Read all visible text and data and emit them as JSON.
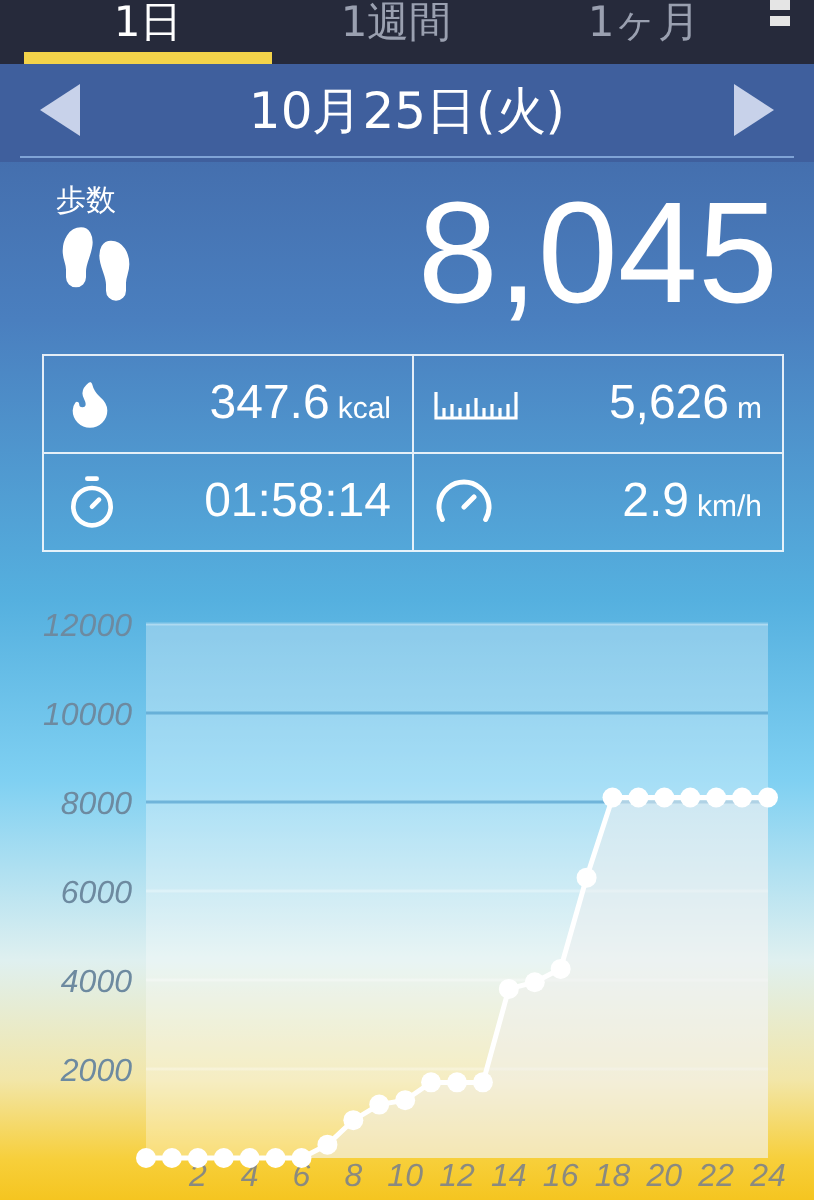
{
  "tabs": [
    {
      "label": "1日",
      "selected": true
    },
    {
      "label": "1週間",
      "selected": false
    },
    {
      "label": "1ヶ月",
      "selected": false
    }
  ],
  "date": "10月25日(火)",
  "steps": {
    "label": "歩数",
    "value": "8,045"
  },
  "stats": [
    {
      "kind": "calories",
      "value": "347.6",
      "unit": "kcal"
    },
    {
      "kind": "distance",
      "value": "5,626",
      "unit": "m"
    },
    {
      "kind": "time",
      "value": "01:58:14"
    },
    {
      "kind": "speed",
      "value": "2.9",
      "unit": "km/h"
    }
  ],
  "chart": {
    "chart_data": {
      "type": "area",
      "x": [
        0,
        1,
        2,
        3,
        4,
        5,
        6,
        7,
        8,
        9,
        10,
        11,
        12,
        13,
        14,
        15,
        16,
        17,
        18,
        19,
        20,
        21,
        22,
        23,
        24
      ],
      "values": [
        0,
        0,
        0,
        0,
        0,
        0,
        0,
        300,
        850,
        1200,
        1300,
        1700,
        1700,
        1700,
        3800,
        3950,
        4250,
        6300,
        8100,
        8100,
        8100,
        8100,
        8100,
        8100,
        8100
      ],
      "xlim": [
        0,
        24
      ],
      "ylim": [
        0,
        12000
      ],
      "grid": true,
      "yticks": [
        2000,
        4000,
        6000,
        8000,
        10000,
        12000
      ],
      "xticks": [
        2,
        4,
        6,
        8,
        10,
        12,
        14,
        16,
        18,
        20,
        22,
        24
      ]
    }
  }
}
